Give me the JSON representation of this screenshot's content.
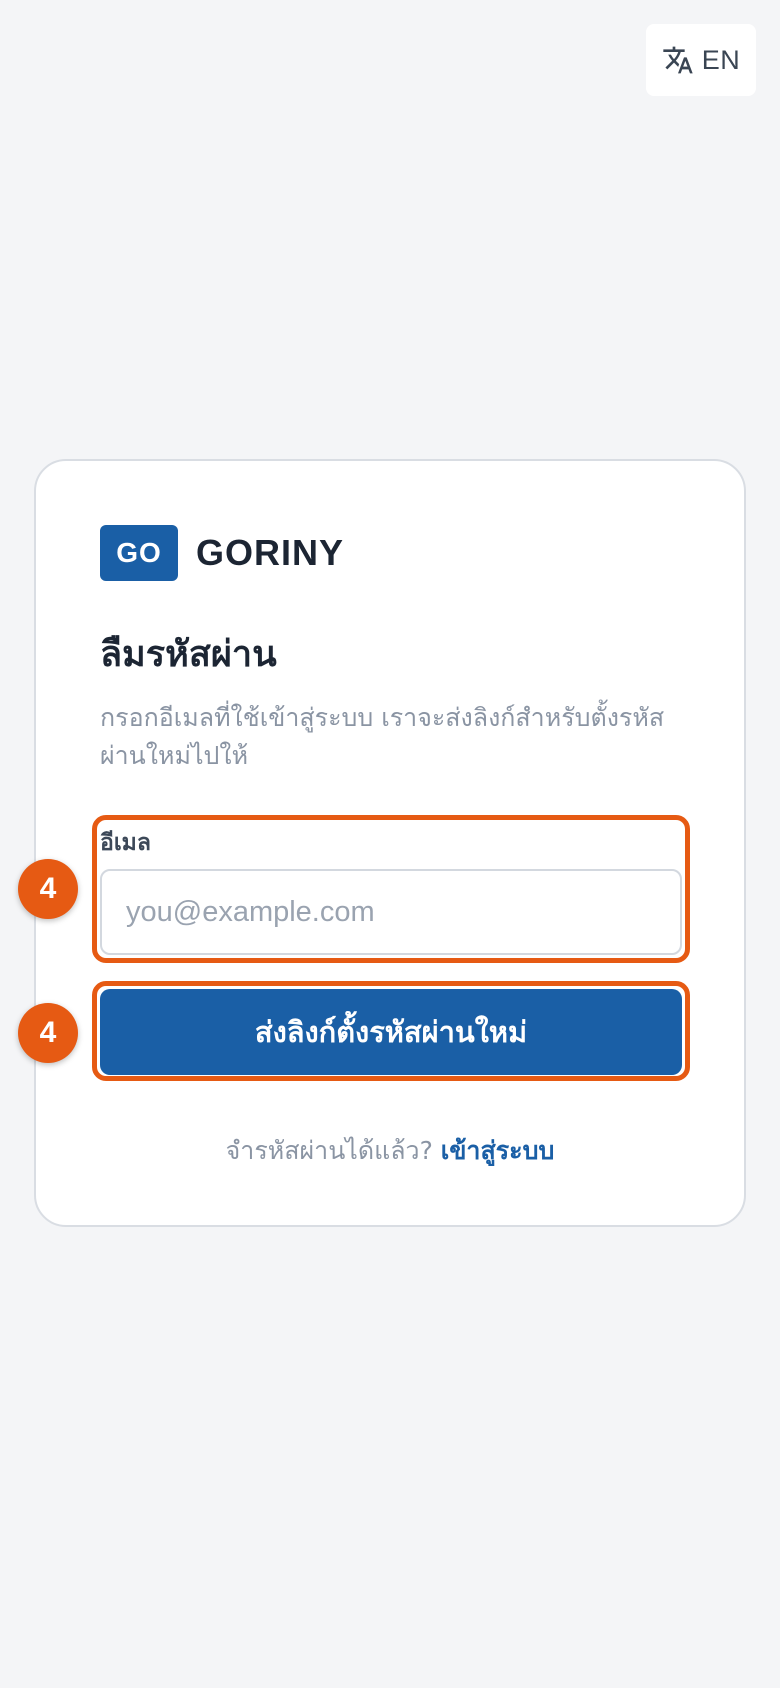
{
  "language_switch": {
    "icon": "translate-icon",
    "label": "EN"
  },
  "brand": {
    "logo_text": "GO",
    "name": "GORINY",
    "accent_color": "#1a5fa6"
  },
  "form": {
    "title": "ลืมรหัสผ่าน",
    "subtitle": "กรอกอีเมลที่ใช้เข้าสู่ระบบ เราจะส่งลิงก์สำหรับตั้งรหัสผ่านใหม่ไปให้",
    "email": {
      "label": "อีเมล",
      "placeholder": "you@example.com",
      "value": ""
    },
    "submit_label": "ส่งลิงก์ตั้งรหัสผ่านใหม่"
  },
  "footer": {
    "prompt": "จำรหัสผ่านได้แล้ว?",
    "login_link": "เข้าสู่ระบบ"
  },
  "annotations": {
    "highlight_color": "#e65a13",
    "badges": [
      "4",
      "4"
    ]
  }
}
